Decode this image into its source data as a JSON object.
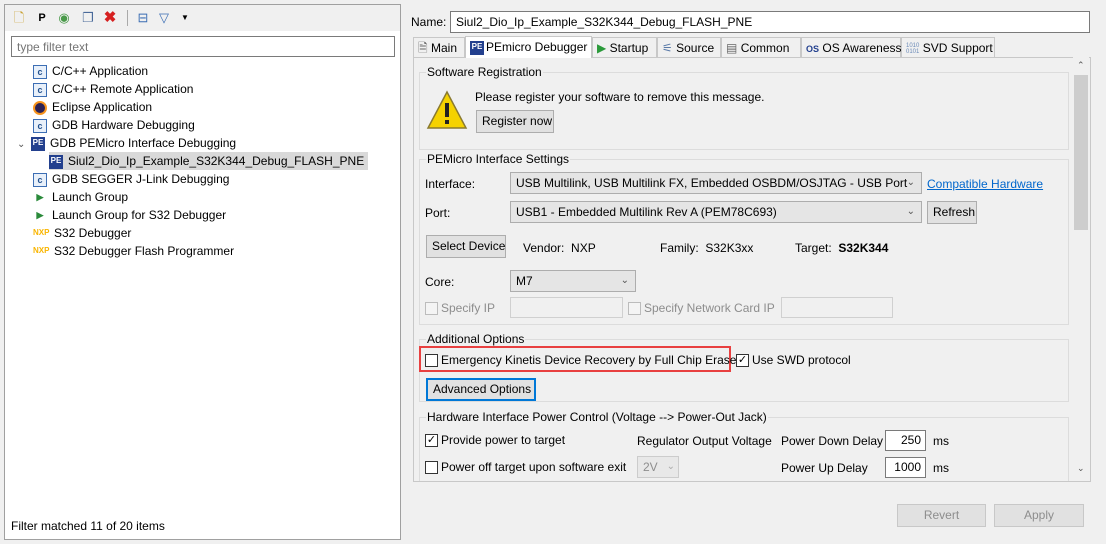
{
  "left_panel": {
    "toolbar": [
      "new-config-icon",
      "new-prototype-icon",
      "export-icon",
      "duplicate-icon",
      "delete-icon",
      "collapse-all-icon",
      "filter-icon",
      "view-menu-icon"
    ],
    "filter_placeholder": "type filter text",
    "tree": [
      {
        "label": "C/C++ Application",
        "icon": "c-icon"
      },
      {
        "label": "C/C++ Remote Application",
        "icon": "c-icon"
      },
      {
        "label": "Eclipse Application",
        "icon": "eclipse-icon"
      },
      {
        "label": "GDB Hardware Debugging",
        "icon": "c-icon"
      },
      {
        "label": "GDB PEMicro Interface Debugging",
        "icon": "pe-icon"
      },
      {
        "label": "Siul2_Dio_Ip_Example_S32K344_Debug_FLASH_PNE",
        "icon": "pe-icon"
      },
      {
        "label": "GDB SEGGER J-Link Debugging",
        "icon": "c-icon"
      },
      {
        "label": "Launch Group",
        "icon": "launch-group-icon"
      },
      {
        "label": "Launch Group for S32 Debugger",
        "icon": "launch-group-icon"
      },
      {
        "label": "S32 Debugger",
        "icon": "nxp-icon"
      },
      {
        "label": "S32 Debugger Flash Programmer",
        "icon": "nxp-icon"
      }
    ],
    "footer": "Filter matched 11 of 20 items"
  },
  "name_label": "Name:",
  "name_value": "Siul2_Dio_Ip_Example_S32K344_Debug_FLASH_PNE",
  "tabs": [
    "Main",
    "PEmicro Debugger",
    "Startup",
    "Source",
    "Common",
    "OS Awareness",
    "SVD Support"
  ],
  "registration": {
    "title": "Software Registration",
    "message": "Please register your software to remove this message.",
    "button": "Register now"
  },
  "interface": {
    "title": "PEMicro Interface Settings",
    "interface_label": "Interface:",
    "interface_value": "USB Multilink, USB Multilink FX, Embedded OSBDM/OSJTAG - USB Port",
    "compatible_link": "Compatible Hardware",
    "port_label": "Port:",
    "port_value": "USB1 - Embedded Multilink Rev A (PEM78C693)",
    "refresh": "Refresh",
    "select_device": "Select Device",
    "vendor_label": "Vendor:",
    "vendor": "NXP",
    "family_label": "Family:",
    "family": "S32K3xx",
    "target_label": "Target:",
    "target": "S32K344",
    "core_label": "Core:",
    "core": "M7",
    "specify_ip": "Specify IP",
    "specify_nic": "Specify Network Card IP"
  },
  "additional": {
    "title": "Additional Options",
    "emergency": "Emergency Kinetis Device Recovery by Full Chip Erase",
    "swd": "Use SWD protocol",
    "advanced": "Advanced Options",
    "highlight_color": "#e84040"
  },
  "power": {
    "title": "Hardware Interface Power Control (Voltage --> Power-Out Jack)",
    "provide": "Provide power to target",
    "poweroff": "Power off target upon software exit",
    "regulator_label": "Regulator Output Voltage",
    "regulator_value": "2V",
    "down_label": "Power Down Delay",
    "down_value": "250",
    "up_label": "Power Up Delay",
    "up_value": "1000",
    "unit": "ms"
  },
  "buttons": {
    "revert": "Revert",
    "apply": "Apply"
  }
}
